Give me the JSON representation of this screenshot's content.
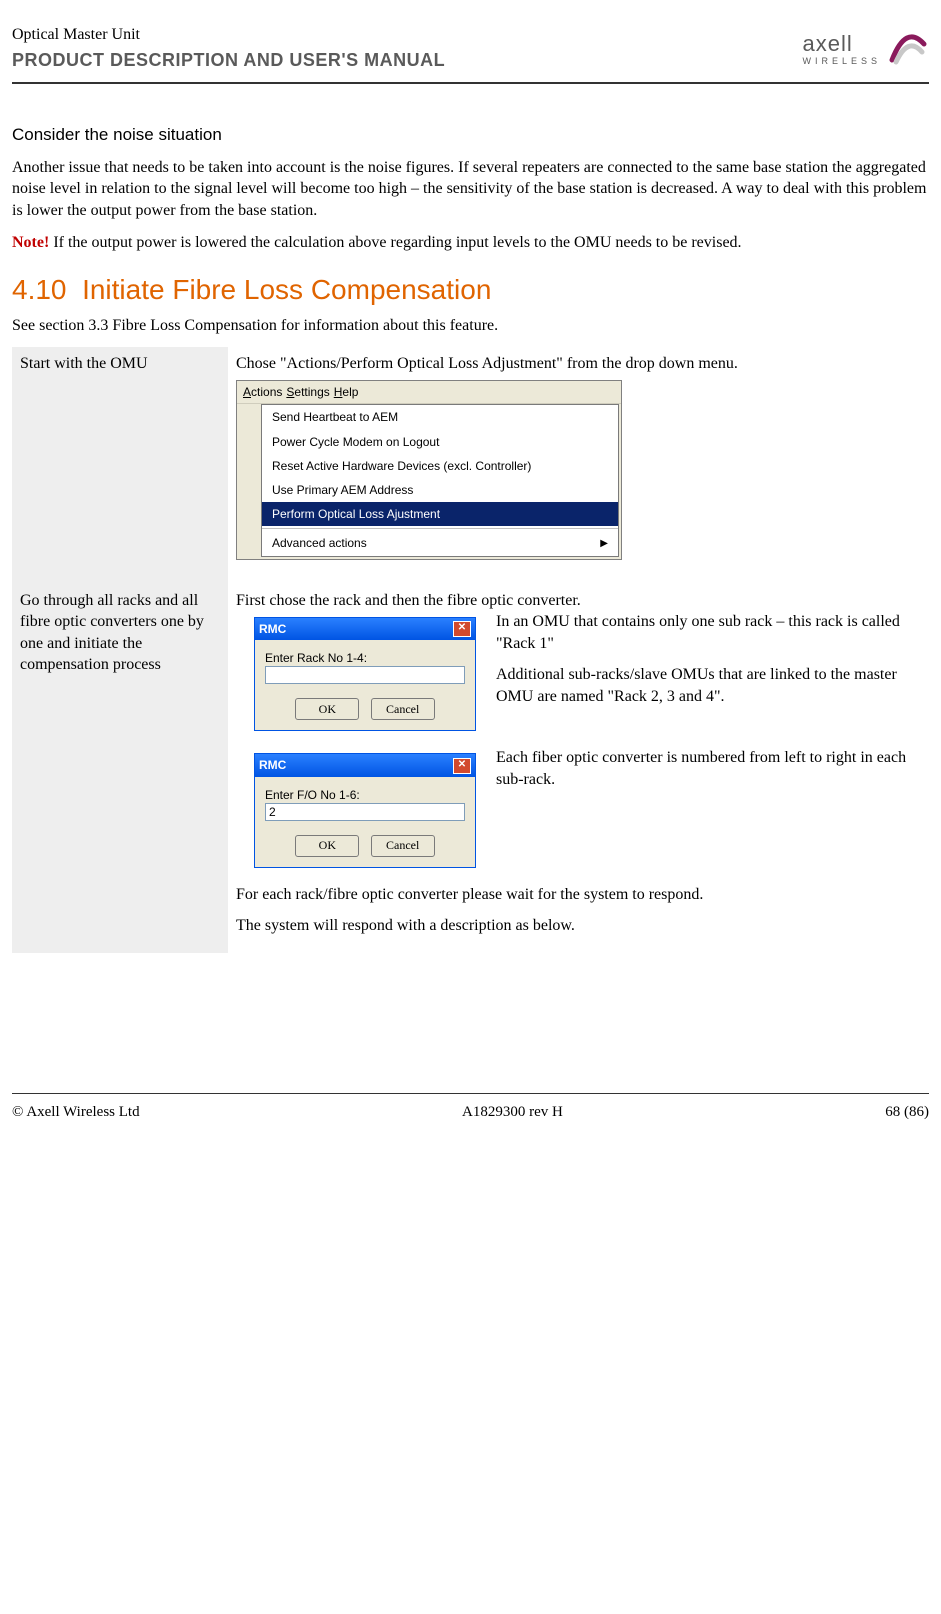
{
  "header": {
    "product": "Optical Master Unit",
    "doc": "PRODUCT DESCRIPTION AND USER'S MANUAL",
    "brand": "axell",
    "brand_sub": "WIRELESS"
  },
  "noise": {
    "heading": "Consider the noise situation",
    "para": "Another issue that needs to be taken into account is the noise figures. If several repeaters are connected to the same base station the aggregated noise level in relation to the signal level will become too high – the sensitivity of the base station is decreased. A way to deal with this problem is lower the output power from the base station.",
    "note_label": "Note!",
    "note_text": " If the output power is lowered the calculation above regarding input levels to the OMU needs to be revised."
  },
  "section": {
    "number": "4.10",
    "title": "Initiate Fibre Loss Compensation",
    "intro": "See section 3.3 Fibre Loss Compensation for information about this feature."
  },
  "step1": {
    "left": "Start with the OMU",
    "right": "Chose \"Actions/Perform Optical Loss Adjustment\" from the drop down menu.",
    "menubar": {
      "actions": "Actions",
      "settings": "Settings",
      "help": "Help"
    },
    "menu": {
      "i1": "Send Heartbeat to AEM",
      "i2": "Power Cycle Modem on Logout",
      "i3": "Reset Active Hardware Devices (excl. Controller)",
      "i4": "Use Primary AEM Address",
      "i5": "Perform Optical Loss Ajustment",
      "i6": "Advanced actions"
    }
  },
  "step2": {
    "left": "Go through all racks and all fibre optic converters one by one and initiate the compensation process",
    "right_intro": "First chose the rack and then the fibre optic converter.",
    "dlg1": {
      "title": "RMC",
      "label": "Enter Rack No 1-4:",
      "value": "",
      "ok": "OK",
      "cancel": "Cancel"
    },
    "dlg1_side1": "In an OMU that contains only one sub rack – this rack is called \"Rack 1\"",
    "dlg1_side2": "Additional sub-racks/slave OMUs that are linked to the master OMU are named \"Rack 2, 3 and 4\".",
    "dlg2": {
      "title": "RMC",
      "label": "Enter F/O No 1-6:",
      "value": "2",
      "ok": "OK",
      "cancel": "Cancel"
    },
    "dlg2_side": "Each fiber optic converter is numbered from left to right in each sub-rack.",
    "after1": "For each rack/fibre optic converter please wait for the system to respond.",
    "after2": "The system will respond with a description as below."
  },
  "footer": {
    "left": "© Axell Wireless Ltd",
    "mid": "A1829300 rev H",
    "right": "68 (86)"
  }
}
